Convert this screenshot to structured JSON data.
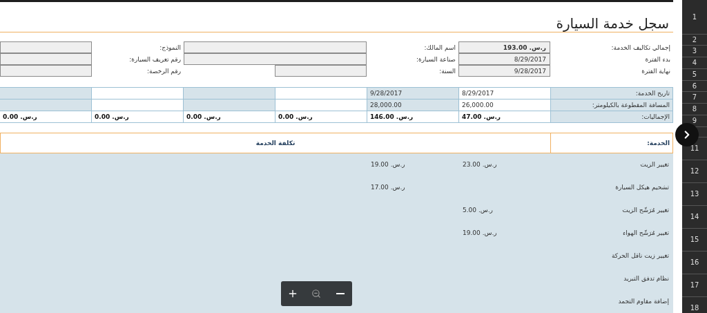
{
  "title": "سجل خدمة السيارة",
  "summary_rows": [
    {
      "fields": [
        {
          "kind": "total",
          "label": "إجمالي تكاليف الخدمة:",
          "value": "ر.س. 193.00"
        },
        {
          "kind": "wide",
          "label": "اسم المالك:"
        },
        {
          "kind": "field",
          "label": "النموذج:"
        }
      ]
    },
    {
      "fields": [
        {
          "kind": "field",
          "label": "بدء الفترة",
          "value": "8/29/2017"
        },
        {
          "kind": "wide",
          "label": "صناعة السيارة:"
        },
        {
          "kind": "field",
          "label": "رقم تعريف السيارة:"
        }
      ]
    },
    {
      "fields": [
        {
          "kind": "field",
          "label": "نهاية الفترة",
          "value": "9/28/2017"
        },
        {
          "kind": "field",
          "label": "السنة:"
        },
        {
          "kind": "field",
          "label": "رقم الرخصة:"
        }
      ]
    }
  ],
  "log": [
    {
      "kind": "data",
      "label": "تاريخ الخدمة:",
      "cells": [
        "8/29/2017",
        "9/28/2017"
      ]
    },
    {
      "kind": "data",
      "label": "المسافة المقطوعة بالكيلومتر:",
      "cells": [
        "26,000.00",
        "28,000.00"
      ]
    },
    {
      "kind": "totals",
      "label": "الإجماليات:",
      "cells": [
        "ر.س. 47.00",
        "ر.س. 146.00",
        "ر.س. 0.00",
        "ر.س. 0.00",
        "ر.س. 0.00",
        "ر.س. 0.00"
      ]
    }
  ],
  "services": {
    "header": {
      "label": "الخدمة:",
      "cost": "تكلفة الخدمة"
    },
    "rows": [
      {
        "name": "تغيير الزيت",
        "cost_1": "ر.س. 23.00",
        "cost_2": "ر.س. 19.00"
      },
      {
        "name": "تشحيم هيكل السيارة",
        "cost_2": "ر.س. 17.00"
      },
      {
        "name": "تغيير مُرَشّح الزيت",
        "cost_1": "ر.س. 5.00"
      },
      {
        "name": "تغيير مُرَشّح الهواء",
        "cost_1": "ر.س. 19.00"
      },
      {
        "name": "تغيير زيت ناقل الحركة"
      },
      {
        "name": "نظام تدفق التبريد"
      },
      {
        "name": "إضافة مقاوم التجمد"
      }
    ]
  },
  "row_numbers": [
    "1",
    "2",
    "3",
    "4",
    "5",
    "6",
    "7",
    "8",
    "9",
    "11",
    "12",
    "13",
    "14",
    "15",
    "16",
    "17",
    "18"
  ]
}
